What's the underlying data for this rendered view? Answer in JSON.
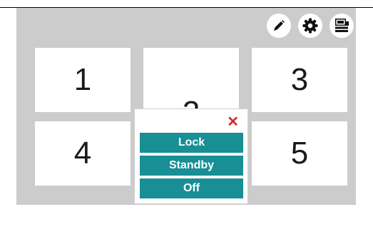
{
  "toolbar": {
    "edit_icon": "pencil-icon",
    "settings_icon": "gear-icon",
    "display_icon": "monitor-stack-icon"
  },
  "tiles": [
    "1",
    "2",
    "3",
    "4",
    "5"
  ],
  "menu": {
    "close_label": "✕",
    "options": [
      "Lock",
      "Standby",
      "Off"
    ]
  },
  "colors": {
    "panel": "#cccccc",
    "button": "#178f94",
    "close": "#d42a2a"
  }
}
